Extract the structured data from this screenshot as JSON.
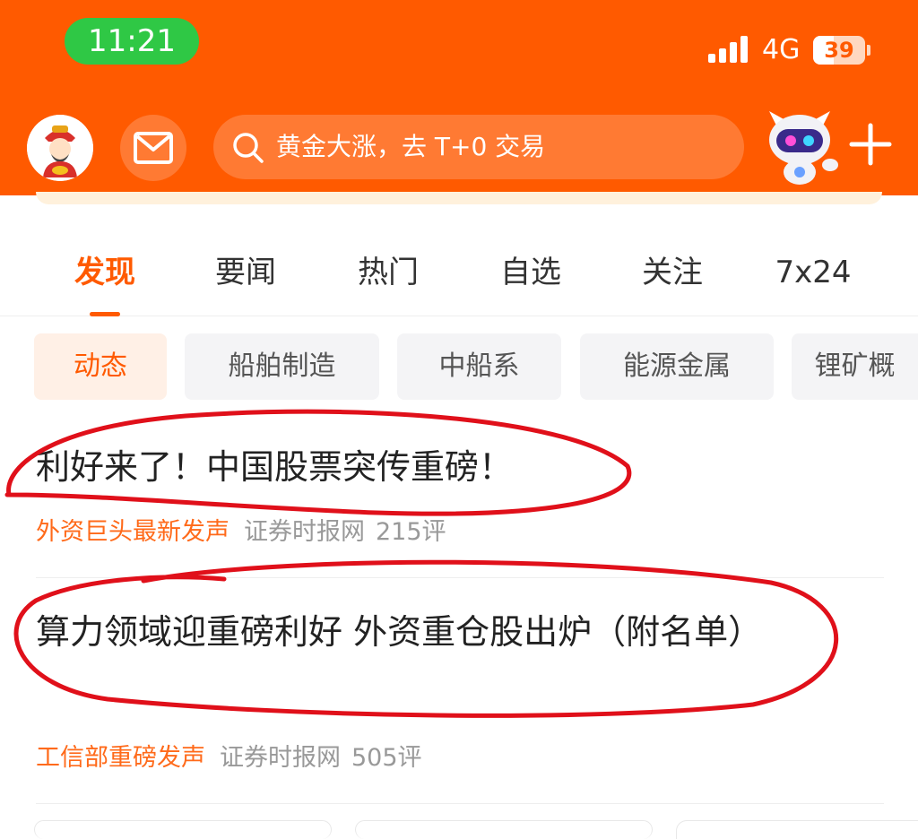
{
  "status_bar": {
    "time": "11:21",
    "network": "4G",
    "battery": "39",
    "battery_level": 0.39
  },
  "header": {
    "search_placeholder": "黄金大涨，去 T+0 交易",
    "icons": {
      "avatar": "avatar-icon",
      "mail": "mail-icon",
      "search": "search-icon",
      "assistant": "robot-icon",
      "add": "plus-icon"
    },
    "brand_color": "#ff5a00"
  },
  "tabs": [
    {
      "label": "发现",
      "active": true
    },
    {
      "label": "要闻"
    },
    {
      "label": "热门"
    },
    {
      "label": "自选"
    },
    {
      "label": "关注"
    },
    {
      "label": "7x24"
    }
  ],
  "chips": [
    {
      "label": "动态",
      "active": true
    },
    {
      "label": "船舶制造"
    },
    {
      "label": "中船系"
    },
    {
      "label": "能源金属"
    },
    {
      "label": "锂矿概"
    }
  ],
  "articles": [
    {
      "title": "利好来了！中国股票突传重磅！",
      "tag": "外资巨头最新发声",
      "source": "证券时报网",
      "comments": "215评"
    },
    {
      "title": "算力领域迎重磅利好 外资重仓股出炉（附名单）",
      "tag": "工信部重磅发声",
      "source": "证券时报网",
      "comments": "505评"
    }
  ],
  "annotation_color": "#e0101a"
}
